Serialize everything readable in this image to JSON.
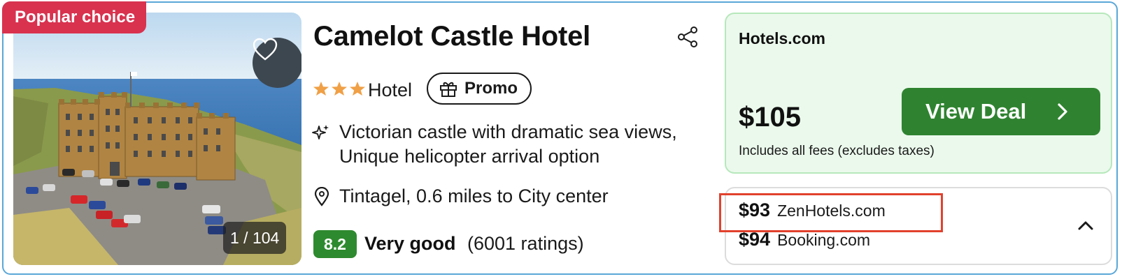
{
  "listing": {
    "badge": "Popular choice",
    "photo_counter": "1 / 104",
    "title": "Camelot Castle Hotel",
    "star_rating": 3,
    "type": "Hotel",
    "promo_label": "Promo",
    "highlights": [
      "Victorian castle with dramatic sea views,",
      "Unique helicopter arrival option"
    ],
    "location": "Tintagel, 0.6 miles to City center",
    "score": "8.2",
    "rating_word": "Very good",
    "rating_count": "(6001 ratings)"
  },
  "main_deal": {
    "provider": "Hotels.com",
    "price": "$105",
    "fees_note": "Includes all fees (excludes taxes)",
    "cta_label": "View Deal"
  },
  "other_deals": [
    {
      "price": "$93",
      "provider": "ZenHotels.com"
    },
    {
      "price": "$94",
      "provider": "Booking.com"
    }
  ],
  "icons": [
    "heart-icon",
    "share-icon",
    "star-icon",
    "gift-icon",
    "sparkle-icon",
    "location-pin-icon",
    "chevron-right-icon",
    "chevron-up-icon"
  ],
  "colors": {
    "badge": "#d8324f",
    "score": "#2e8a2e",
    "cta": "#2f8330",
    "deal_bg": "#ebf9ec",
    "star": "#f0a046",
    "highlight_outline": "#e2412d"
  }
}
